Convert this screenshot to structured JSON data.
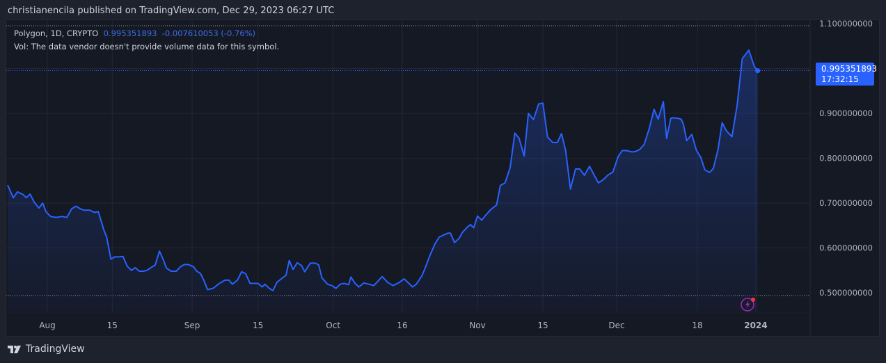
{
  "header": {
    "published": "christianencila published on TradingView.com, Dec 29, 2023 06:27 UTC"
  },
  "legend": {
    "symbol": "Polygon, 1D, CRYPTO",
    "price": "0.995351893",
    "change": "-0.007610053 (-0.76%)",
    "vol_note": "Vol: The data vendor doesn't provide volume data for this symbol."
  },
  "price_tag": {
    "price": "0.995351893",
    "countdown": "17:32:15"
  },
  "footer": {
    "brand": "TradingView"
  },
  "colors": {
    "line": "#2962ff",
    "tag": "#2962ff",
    "background": "#151924",
    "bolt": "#9c27b0"
  },
  "chart_data": {
    "type": "area",
    "title": "Polygon, 1D, CRYPTO",
    "x_unit": "days since Jul 24, 2023",
    "ylim": [
      0.5,
      1.1
    ],
    "y_ticks": [
      "1.100000000",
      "0.900000000",
      "0.800000000",
      "0.700000000",
      "0.600000000",
      "0.500000000"
    ],
    "y_tick_values": [
      1.1,
      0.9,
      0.8,
      0.7,
      0.6,
      0.5
    ],
    "x_ticks": [
      {
        "label": "Aug",
        "day": 8.5
      },
      {
        "label": "15",
        "day": 22.4
      },
      {
        "label": "Sep",
        "day": 39.5
      },
      {
        "label": "15",
        "day": 53.6
      },
      {
        "label": "Oct",
        "day": 69.7
      },
      {
        "label": "16",
        "day": 84.5
      },
      {
        "label": "Nov",
        "day": 100.6
      },
      {
        "label": "15",
        "day": 114.6
      },
      {
        "label": "Dec",
        "day": 130.4
      },
      {
        "label": "18",
        "day": 147.7
      },
      {
        "label": "2024",
        "day": 160.2
      }
    ],
    "last_value": 0.995351893,
    "points": [
      [
        0,
        0.74
      ],
      [
        1.2,
        0.712
      ],
      [
        2.1,
        0.725
      ],
      [
        3.3,
        0.719
      ],
      [
        4.0,
        0.712
      ],
      [
        4.8,
        0.72
      ],
      [
        5.7,
        0.702
      ],
      [
        6.7,
        0.689
      ],
      [
        7.5,
        0.7
      ],
      [
        8.2,
        0.681
      ],
      [
        9.2,
        0.67
      ],
      [
        10.4,
        0.668
      ],
      [
        11.6,
        0.67
      ],
      [
        12.7,
        0.668
      ],
      [
        13.7,
        0.687
      ],
      [
        14.6,
        0.693
      ],
      [
        15.6,
        0.687
      ],
      [
        16.4,
        0.684
      ],
      [
        17.6,
        0.684
      ],
      [
        18.6,
        0.679
      ],
      [
        19.4,
        0.681
      ],
      [
        20.6,
        0.64
      ],
      [
        21.2,
        0.624
      ],
      [
        22.1,
        0.575
      ],
      [
        22.9,
        0.58
      ],
      [
        23.8,
        0.58
      ],
      [
        24.7,
        0.581
      ],
      [
        25.6,
        0.559
      ],
      [
        26.5,
        0.55
      ],
      [
        27.3,
        0.556
      ],
      [
        28.2,
        0.548
      ],
      [
        29.1,
        0.548
      ],
      [
        29.8,
        0.55
      ],
      [
        30.7,
        0.556
      ],
      [
        31.6,
        0.562
      ],
      [
        32.5,
        0.593
      ],
      [
        33.4,
        0.572
      ],
      [
        34.0,
        0.555
      ],
      [
        35.0,
        0.548
      ],
      [
        36.1,
        0.548
      ],
      [
        37.0,
        0.558
      ],
      [
        37.8,
        0.563
      ],
      [
        38.7,
        0.563
      ],
      [
        39.8,
        0.558
      ],
      [
        40.5,
        0.548
      ],
      [
        41.3,
        0.543
      ],
      [
        42.0,
        0.528
      ],
      [
        42.8,
        0.507
      ],
      [
        44.0,
        0.51
      ],
      [
        45.1,
        0.519
      ],
      [
        46.5,
        0.528
      ],
      [
        47.4,
        0.528
      ],
      [
        48.1,
        0.519
      ],
      [
        49.2,
        0.528
      ],
      [
        50.1,
        0.547
      ],
      [
        51.0,
        0.542
      ],
      [
        51.9,
        0.521
      ],
      [
        52.9,
        0.521
      ],
      [
        53.6,
        0.521
      ],
      [
        54.5,
        0.513
      ],
      [
        55.1,
        0.519
      ],
      [
        56.0,
        0.51
      ],
      [
        56.8,
        0.505
      ],
      [
        57.7,
        0.524
      ],
      [
        58.6,
        0.531
      ],
      [
        59.6,
        0.539
      ],
      [
        60.3,
        0.572
      ],
      [
        61.1,
        0.552
      ],
      [
        62.0,
        0.567
      ],
      [
        62.9,
        0.561
      ],
      [
        63.6,
        0.547
      ],
      [
        64.8,
        0.566
      ],
      [
        65.9,
        0.566
      ],
      [
        66.6,
        0.562
      ],
      [
        67.3,
        0.533
      ],
      [
        68.5,
        0.519
      ],
      [
        69.4,
        0.516
      ],
      [
        70.3,
        0.51
      ],
      [
        71.2,
        0.519
      ],
      [
        72.1,
        0.521
      ],
      [
        73.0,
        0.518
      ],
      [
        73.5,
        0.535
      ],
      [
        74.4,
        0.521
      ],
      [
        75.2,
        0.513
      ],
      [
        76.3,
        0.522
      ],
      [
        78.4,
        0.516
      ],
      [
        80.2,
        0.536
      ],
      [
        81.4,
        0.523
      ],
      [
        82.5,
        0.516
      ],
      [
        83.7,
        0.522
      ],
      [
        84.9,
        0.531
      ],
      [
        86.7,
        0.513
      ],
      [
        87.5,
        0.519
      ],
      [
        88.7,
        0.538
      ],
      [
        89.4,
        0.555
      ],
      [
        90.4,
        0.583
      ],
      [
        91.5,
        0.609
      ],
      [
        92.4,
        0.624
      ],
      [
        93.4,
        0.629
      ],
      [
        94.3,
        0.633
      ],
      [
        94.8,
        0.633
      ],
      [
        95.7,
        0.612
      ],
      [
        96.7,
        0.622
      ],
      [
        97.4,
        0.635
      ],
      [
        98.5,
        0.647
      ],
      [
        99.1,
        0.652
      ],
      [
        99.8,
        0.645
      ],
      [
        100.6,
        0.671
      ],
      [
        101.5,
        0.662
      ],
      [
        102.2,
        0.671
      ],
      [
        103.4,
        0.685
      ],
      [
        104.7,
        0.696
      ],
      [
        105.5,
        0.739
      ],
      [
        106.5,
        0.745
      ],
      [
        107.6,
        0.779
      ],
      [
        108.6,
        0.856
      ],
      [
        109.5,
        0.845
      ],
      [
        110.6,
        0.805
      ],
      [
        111.5,
        0.9
      ],
      [
        112.6,
        0.886
      ],
      [
        113.7,
        0.921
      ],
      [
        114.6,
        0.923
      ],
      [
        115.6,
        0.847
      ],
      [
        116.7,
        0.835
      ],
      [
        117.7,
        0.835
      ],
      [
        118.6,
        0.855
      ],
      [
        119.5,
        0.816
      ],
      [
        120.5,
        0.731
      ],
      [
        121.6,
        0.776
      ],
      [
        122.5,
        0.776
      ],
      [
        123.5,
        0.762
      ],
      [
        124.6,
        0.782
      ],
      [
        125.6,
        0.762
      ],
      [
        126.5,
        0.745
      ],
      [
        127.5,
        0.752
      ],
      [
        128.6,
        0.763
      ],
      [
        129.6,
        0.769
      ],
      [
        130.7,
        0.803
      ],
      [
        131.6,
        0.817
      ],
      [
        132.5,
        0.817
      ],
      [
        133.7,
        0.814
      ],
      [
        134.5,
        0.815
      ],
      [
        135.4,
        0.82
      ],
      [
        136.3,
        0.831
      ],
      [
        137.4,
        0.867
      ],
      [
        138.4,
        0.909
      ],
      [
        139.3,
        0.887
      ],
      [
        140.4,
        0.926
      ],
      [
        141.1,
        0.844
      ],
      [
        142.0,
        0.889
      ],
      [
        142.4,
        0.89
      ],
      [
        143.5,
        0.889
      ],
      [
        144.2,
        0.887
      ],
      [
        144.7,
        0.876
      ],
      [
        145.4,
        0.839
      ],
      [
        146.5,
        0.853
      ],
      [
        147.5,
        0.817
      ],
      [
        148.4,
        0.802
      ],
      [
        149.3,
        0.774
      ],
      [
        150.3,
        0.768
      ],
      [
        151.1,
        0.777
      ],
      [
        152.1,
        0.819
      ],
      [
        153.0,
        0.879
      ],
      [
        153.9,
        0.861
      ],
      [
        155.1,
        0.848
      ],
      [
        156.2,
        0.918
      ],
      [
        157.3,
        1.022
      ],
      [
        158.7,
        1.041
      ],
      [
        159.9,
        1.004
      ],
      [
        160.6,
        0.995
      ]
    ]
  }
}
